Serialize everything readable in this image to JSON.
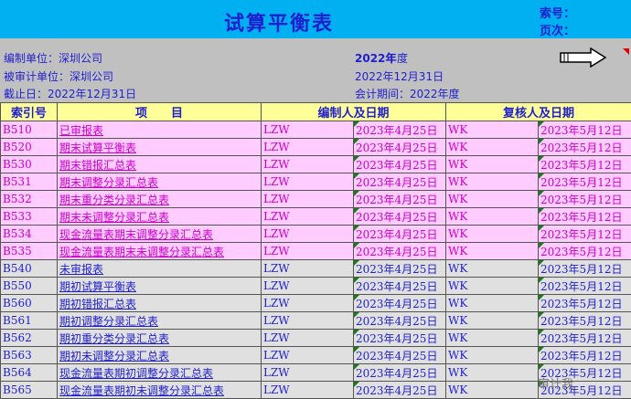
{
  "header": {
    "title": "试算平衡表",
    "index_label": "索号：",
    "page_label": "页次："
  },
  "info": {
    "company_label": "编制单位：深圳公司",
    "audited_label": "被审计单位：深圳公司",
    "cutoff_label": "截止日：2022年12月31日",
    "year_label": "2022年",
    "year_suffix": "年度",
    "date_label": "2022年12月31日",
    "period_label": "会计期间：2022年度"
  },
  "table": {
    "headers": [
      "索引号",
      "项　　目",
      "编制人及日期",
      "复核人及日期"
    ],
    "rows": [
      {
        "style": "pink",
        "id": "B510",
        "item": "已审报表",
        "preparer": "LZW",
        "prep_date": "2023年4月25日",
        "reviewer": "WK",
        "rev_date": "2023年5月12日"
      },
      {
        "style": "pink",
        "id": "B520",
        "item": "期末试算平衡表",
        "preparer": "LZW",
        "prep_date": "2023年4月25日",
        "reviewer": "WK",
        "rev_date": "2023年5月12日"
      },
      {
        "style": "pink",
        "id": "B530",
        "item": "期末错报汇总表",
        "preparer": "LZW",
        "prep_date": "2023年4月25日",
        "reviewer": "WK",
        "rev_date": "2023年5月12日"
      },
      {
        "style": "pink",
        "id": "B531",
        "item": "期末调整分录汇总表",
        "preparer": "LZW",
        "prep_date": "2023年4月25日",
        "reviewer": "WK",
        "rev_date": "2023年5月12日"
      },
      {
        "style": "pink",
        "id": "B532",
        "item": "期末重分类分录汇总表",
        "preparer": "LZW",
        "prep_date": "2023年4月25日",
        "reviewer": "WK",
        "rev_date": "2023年5月12日"
      },
      {
        "style": "pink",
        "id": "B533",
        "item": "期末未调整分录汇总表",
        "preparer": "LZW",
        "prep_date": "2023年4月25日",
        "reviewer": "WK",
        "rev_date": "2023年5月12日"
      },
      {
        "style": "pink",
        "id": "B534",
        "item": "现金流量表期末调整分录汇总表",
        "preparer": "LZW",
        "prep_date": "2023年4月25日",
        "reviewer": "WK",
        "rev_date": "2023年5月12日"
      },
      {
        "style": "pink",
        "id": "B535",
        "item": "现金流量表期末未调整分录汇总表",
        "preparer": "LZW",
        "prep_date": "2023年4月25日",
        "reviewer": "WK",
        "rev_date": "2023年5月12日"
      },
      {
        "style": "gray",
        "id": "B540",
        "item": "未审报表",
        "preparer": "LZW",
        "prep_date": "2023年4月25日",
        "reviewer": "WK",
        "rev_date": "2023年5月12日"
      },
      {
        "style": "gray",
        "id": "B550",
        "item": "期初试算平衡表",
        "preparer": "LZW",
        "prep_date": "2023年4月25日",
        "reviewer": "WK",
        "rev_date": "2023年5月12日"
      },
      {
        "style": "gray",
        "id": "B560",
        "item": "期初错报汇总表",
        "preparer": "LZW",
        "prep_date": "2023年4月25日",
        "reviewer": "WK",
        "rev_date": "2023年5月12日"
      },
      {
        "style": "gray",
        "id": "B561",
        "item": "期初调整分录汇总表",
        "preparer": "LZW",
        "prep_date": "2023年4月25日",
        "reviewer": "WK",
        "rev_date": "2023年5月12日"
      },
      {
        "style": "gray",
        "id": "B562",
        "item": "期初重分类分录汇总表",
        "preparer": "LZW",
        "prep_date": "2023年4月25日",
        "reviewer": "WK",
        "rev_date": "2023年5月12日"
      },
      {
        "style": "gray",
        "id": "B563",
        "item": "期初未调整分录汇总表",
        "preparer": "LZW",
        "prep_date": "2023年4月25日",
        "reviewer": "WK",
        "rev_date": "2023年5月12日"
      },
      {
        "style": "gray",
        "id": "B564",
        "item": "现金流量表期初调整分录汇总表",
        "preparer": "LZW",
        "prep_date": "2023年4月25日",
        "reviewer": "WK",
        "rev_date": "2023年5月12日"
      },
      {
        "style": "gray",
        "id": "B565",
        "item": "现金流量表期初未调整分录汇总表",
        "preparer": "LZW",
        "prep_date": "2023年4月25日",
        "reviewer": "WK",
        "rev_date": "2023年5月12日"
      }
    ]
  },
  "watermark": "审计我",
  "colors": {
    "title_bar": "#00b0f0",
    "header_row": "#ffff99",
    "pink_row": "#ffccff",
    "gray_row": "#e0e0e0",
    "text_blue": "#1f1fd0",
    "text_magenta": "#cc00cc"
  },
  "icons": {
    "next": "right-arrow-icon"
  }
}
